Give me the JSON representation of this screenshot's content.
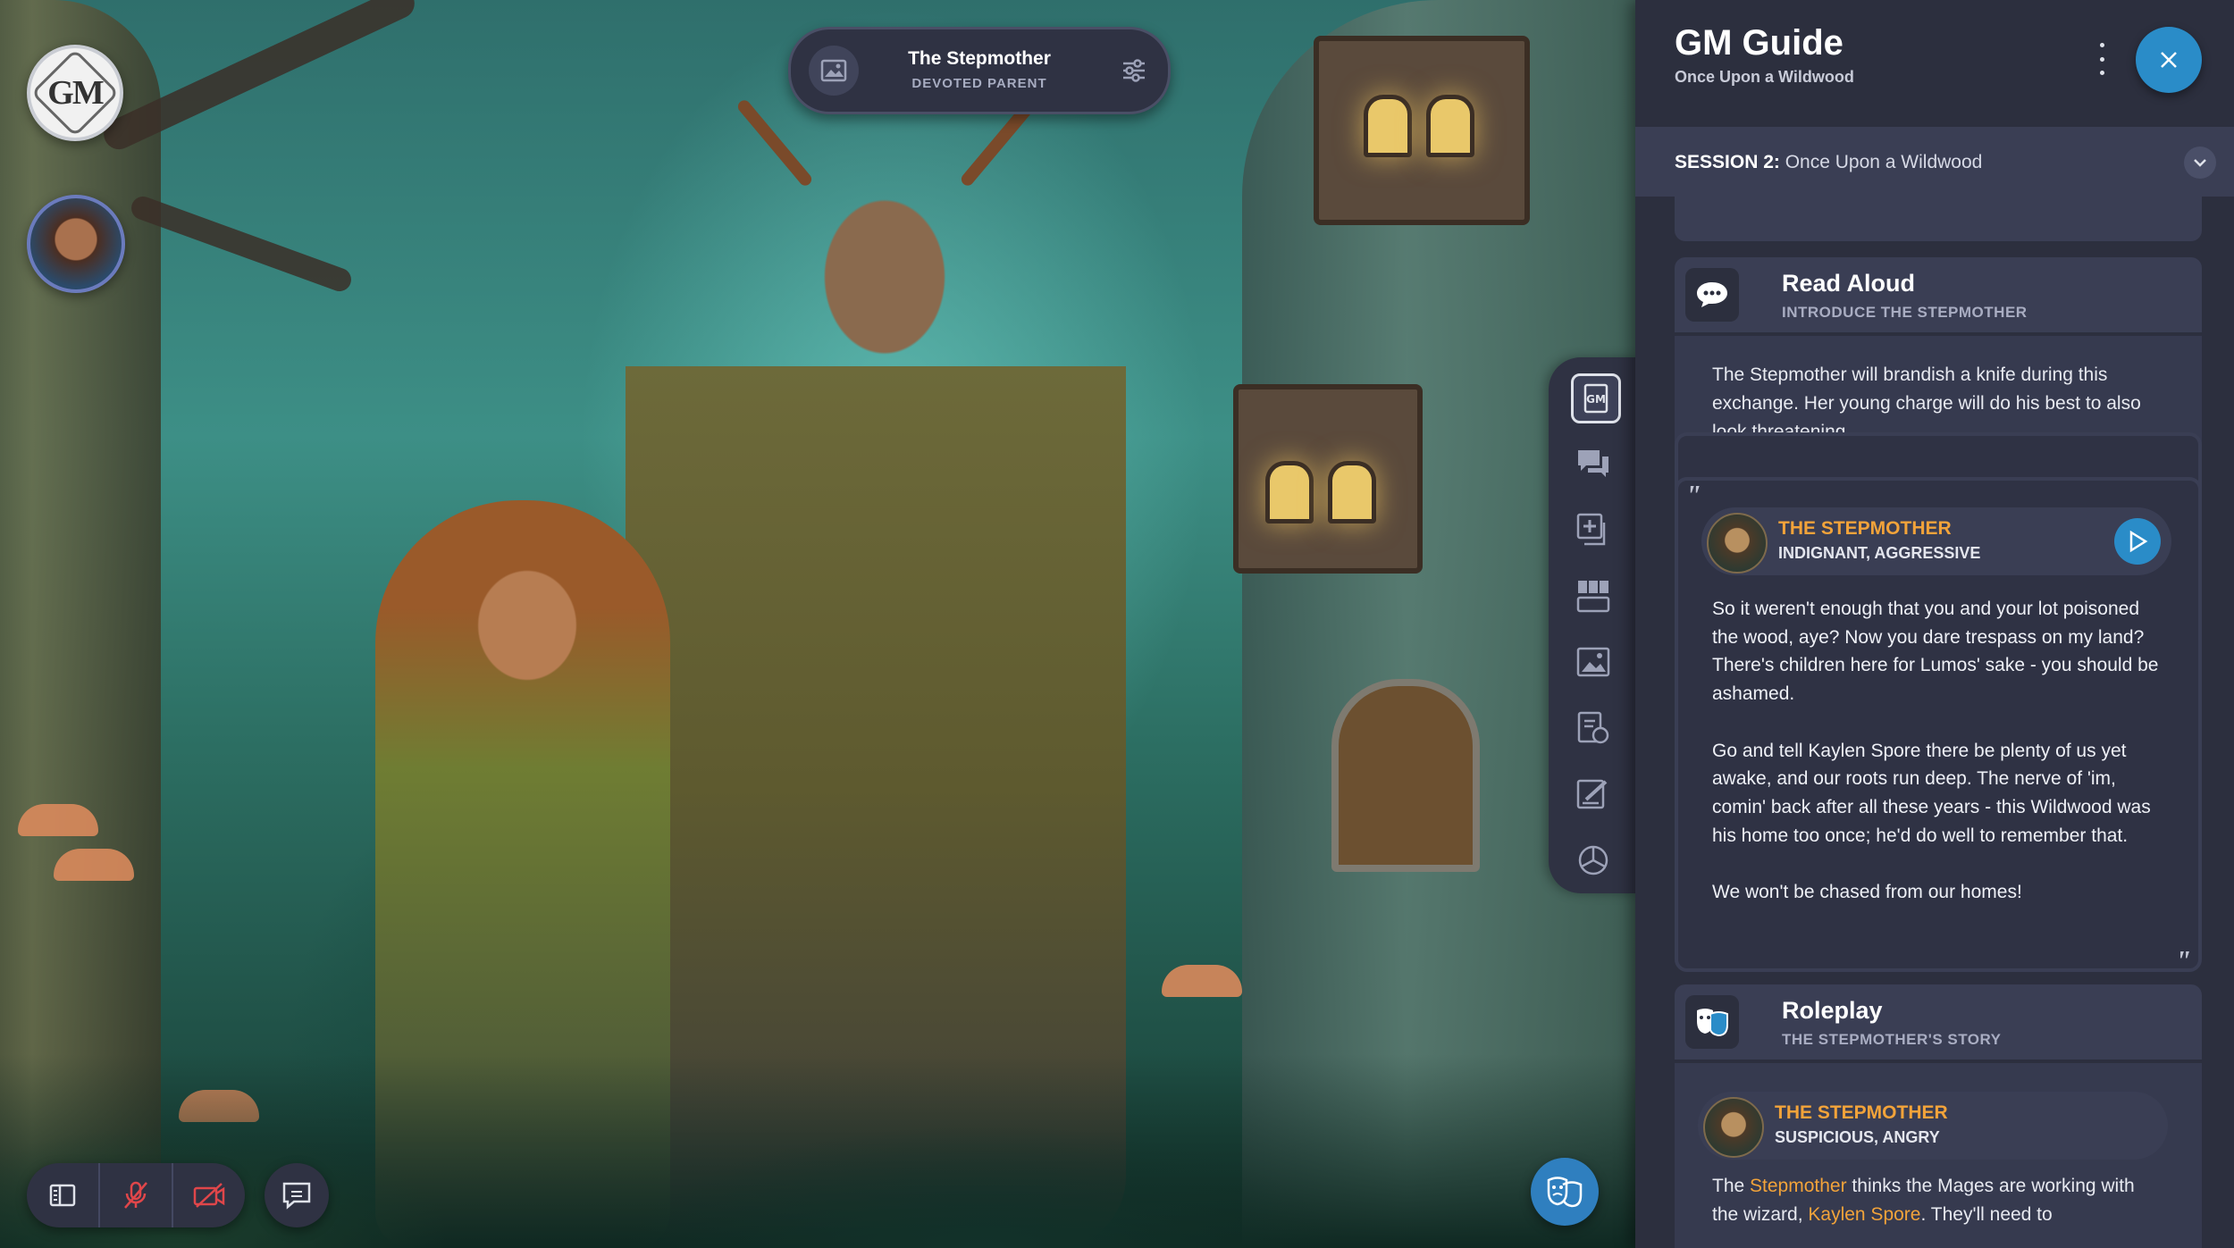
{
  "scene_pill": {
    "name": "The Stepmother",
    "subtitle": "DEVOTED PARENT",
    "image_icon": "image-icon",
    "settings_icon": "sliders-icon"
  },
  "gm_badge": {
    "label": "GM"
  },
  "rail_tools": [
    {
      "icon": "gm-guide-icon"
    },
    {
      "icon": "chat-messages-icon"
    },
    {
      "icon": "add-media-icon"
    },
    {
      "icon": "character-grid-icon"
    },
    {
      "icon": "scene-image-icon"
    },
    {
      "icon": "handouts-icon"
    },
    {
      "icon": "notes-edit-icon"
    },
    {
      "icon": "dice-icon"
    }
  ],
  "bottom_controls": [
    {
      "icon": "layout-icon"
    },
    {
      "icon": "mic-off-icon"
    },
    {
      "icon": "camera-off-icon"
    }
  ],
  "chat_button_icon": "chat-icon",
  "mask_button_icon": "theater-masks-icon",
  "panel": {
    "title": "GM Guide",
    "subtitle": "Once Upon a Wildwood",
    "session_prefix": "SESSION 2:",
    "session_name": "Once Upon a Wildwood",
    "accent": "#2a8cc8",
    "highlight": "#f2a33a"
  },
  "read_aloud": {
    "title": "Read Aloud",
    "subtitle": "INTRODUCE THE STEPMOTHER",
    "description": "The Stepmother will brandish a knife during this exchange. Her young charge will do his best to also look threatening.",
    "speaker_name": "THE STEPMOTHER",
    "speaker_mood": "INDIGNANT, AGGRESSIVE",
    "quote_paragraphs": [
      "So it weren't enough that you and your lot poisoned the wood, aye? Now you dare trespass on my land? There's children here for Lumos' sake - you should be ashamed.",
      "Go and tell Kaylen Spore there be plenty of us yet awake, and our roots run deep. The nerve of 'im, comin' back after all these years - this Wildwood was his home too once; he'd do well to remember that.",
      "We won't be chased from our homes!"
    ]
  },
  "roleplay": {
    "title": "Roleplay",
    "subtitle": "THE STEPMOTHER'S STORY",
    "speaker_name": "THE STEPMOTHER",
    "speaker_mood": "SUSPICIOUS, ANGRY",
    "text_start": "The ",
    "text_link1": "Stepmother",
    "text_mid": " thinks the Mages are working with the wizard, ",
    "text_link2": "Kaylen Spore",
    "text_end": ". They'll need to"
  }
}
